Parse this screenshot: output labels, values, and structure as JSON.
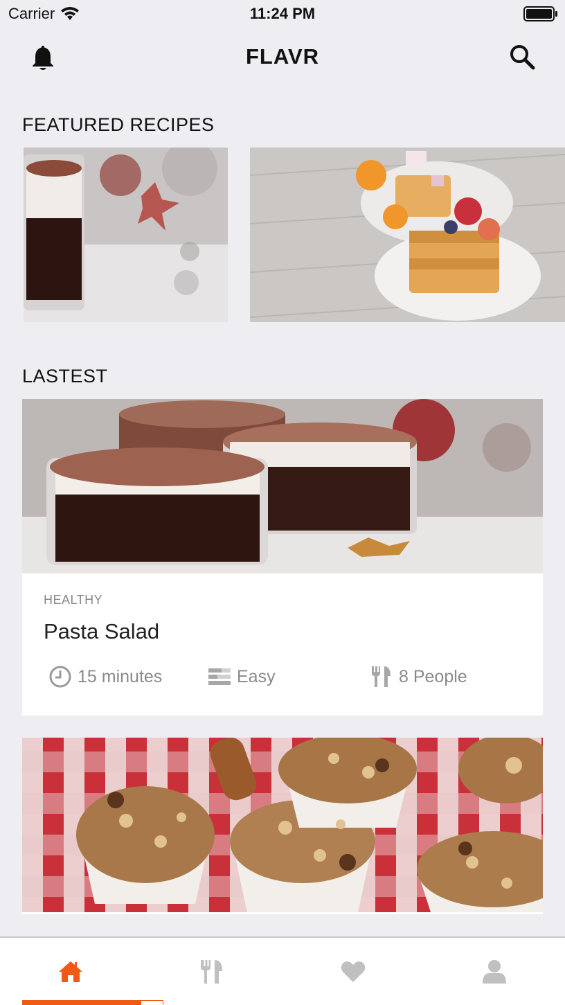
{
  "status_bar": {
    "carrier": "Carrier",
    "time": "11:24 PM"
  },
  "nav": {
    "title": "FLAVR"
  },
  "featured": {
    "title": "FEATURED RECIPES"
  },
  "latest": {
    "title": "LASTEST",
    "recipes": [
      {
        "category": "HEALTHY",
        "name": "Pasta Salad",
        "time": "15 minutes",
        "difficulty": "Easy",
        "servings": "8 People"
      }
    ]
  },
  "colors": {
    "accent": "#f05a14",
    "inactive_icon": "#c0c0c0",
    "background": "#ededf2"
  },
  "tabs": {
    "active": "home",
    "icons": [
      "home-icon",
      "utensils-icon",
      "heart-icon",
      "user-icon"
    ]
  }
}
